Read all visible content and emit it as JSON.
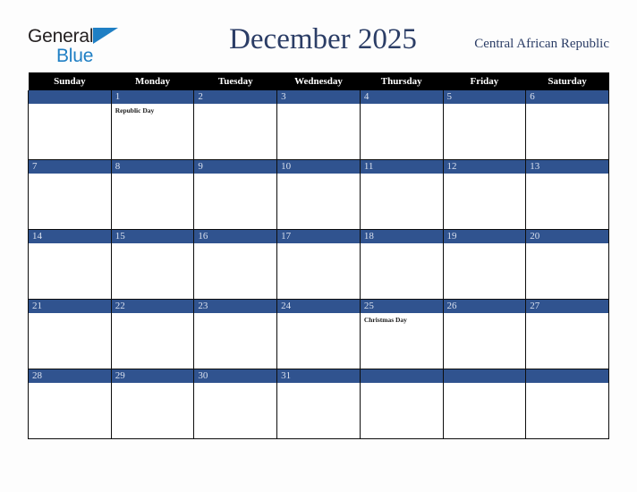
{
  "branding": {
    "logo_primary": "General",
    "logo_secondary": "Blue",
    "logo_primary_color": "#231f20",
    "logo_secondary_color": "#1f7fc4"
  },
  "header": {
    "title": "December 2025",
    "country": "Central African Republic",
    "title_color": "#2b3d66"
  },
  "theme": {
    "header_row_bg": "#000000",
    "header_row_text": "#ffffff",
    "date_bar_bg": "#30538f",
    "date_bar_text": "#d9e0ee",
    "cell_bg": "#ffffff",
    "page_bg": "#fdfdfd",
    "grid_line": "#0d0d0d"
  },
  "weekdays": [
    "Sunday",
    "Monday",
    "Tuesday",
    "Wednesday",
    "Thursday",
    "Friday",
    "Saturday"
  ],
  "weeks": [
    [
      {
        "day": "",
        "events": []
      },
      {
        "day": "1",
        "events": [
          "Republic Day"
        ]
      },
      {
        "day": "2",
        "events": []
      },
      {
        "day": "3",
        "events": []
      },
      {
        "day": "4",
        "events": []
      },
      {
        "day": "5",
        "events": []
      },
      {
        "day": "6",
        "events": []
      }
    ],
    [
      {
        "day": "7",
        "events": []
      },
      {
        "day": "8",
        "events": []
      },
      {
        "day": "9",
        "events": []
      },
      {
        "day": "10",
        "events": []
      },
      {
        "day": "11",
        "events": []
      },
      {
        "day": "12",
        "events": []
      },
      {
        "day": "13",
        "events": []
      }
    ],
    [
      {
        "day": "14",
        "events": []
      },
      {
        "day": "15",
        "events": []
      },
      {
        "day": "16",
        "events": []
      },
      {
        "day": "17",
        "events": []
      },
      {
        "day": "18",
        "events": []
      },
      {
        "day": "19",
        "events": []
      },
      {
        "day": "20",
        "events": []
      }
    ],
    [
      {
        "day": "21",
        "events": []
      },
      {
        "day": "22",
        "events": []
      },
      {
        "day": "23",
        "events": []
      },
      {
        "day": "24",
        "events": []
      },
      {
        "day": "25",
        "events": [
          "Christmas Day"
        ]
      },
      {
        "day": "26",
        "events": []
      },
      {
        "day": "27",
        "events": []
      }
    ],
    [
      {
        "day": "28",
        "events": []
      },
      {
        "day": "29",
        "events": []
      },
      {
        "day": "30",
        "events": []
      },
      {
        "day": "31",
        "events": []
      },
      {
        "day": "",
        "events": []
      },
      {
        "day": "",
        "events": []
      },
      {
        "day": "",
        "events": []
      }
    ]
  ]
}
